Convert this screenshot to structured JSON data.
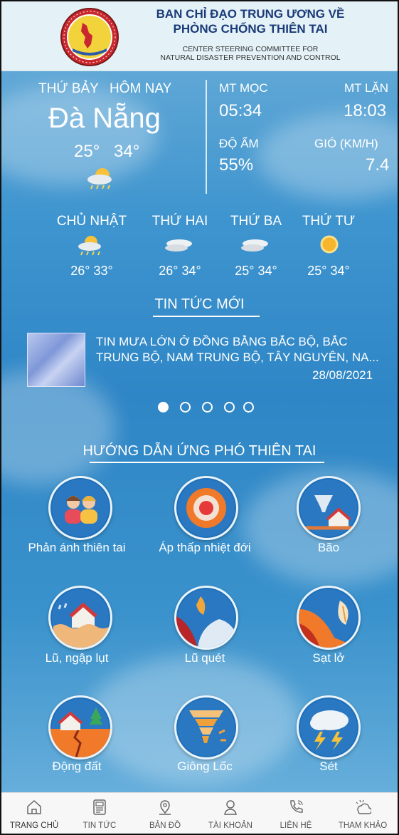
{
  "header": {
    "title_line1": "BAN CHỈ ĐẠO TRUNG ƯƠNG VỀ",
    "title_line2": "PHÒNG CHỐNG THIÊN TAI",
    "subtitle_line1": "CENTER STEERING COMMITTEE FOR",
    "subtitle_line2": "NATURAL DISASTER PREVENTION AND CONTROL",
    "logo_icon": "emblem-seal-icon"
  },
  "weather": {
    "day": "THỨ BẢY",
    "today": "HÔM NAY",
    "city": "Đà Nẵng",
    "temp_min": "25°",
    "temp_max": "34°",
    "icon": "partly-cloudy-rain-icon",
    "sunrise_label": "MT MỌC",
    "sunrise_value": "05:34",
    "sunset_label": "MT LẶN",
    "sunset_value": "18:03",
    "humidity_label": "ĐỘ ẨM",
    "humidity_value": "55%",
    "wind_label": "GIÓ (KM/H)",
    "wind_value": "7.4"
  },
  "forecast": [
    {
      "day": "CHỦ NHẬT",
      "temp": "26° 33°",
      "icon": "partly-cloudy-rain-icon"
    },
    {
      "day": "THỨ HAI",
      "temp": "26° 34°",
      "icon": "cloudy-icon"
    },
    {
      "day": "THỨ BA",
      "temp": "25° 34°",
      "icon": "cloudy-icon"
    },
    {
      "day": "THỨ TƯ",
      "temp": "25° 34°",
      "icon": "sunny-icon"
    }
  ],
  "news": {
    "section_title": "TIN TỨC MỚI",
    "line1": "TIN MƯA LỚN Ở ĐỒNG BẰNG BẮC BỘ, BẮC",
    "line2": "TRUNG BỘ, NAM TRUNG BỘ, TÂY NGUYÊN, NA...",
    "date": "28/08/2021",
    "carousel_pages": 5,
    "active_page": 1
  },
  "guide": {
    "section_title": "HƯỚNG DẪN ỨNG PHÓ THIÊN TAI",
    "items": [
      {
        "label": "Phản ánh thiên tai",
        "icon": "people-report-icon"
      },
      {
        "label": "Áp thấp nhiệt đới",
        "icon": "target-low-pressure-icon"
      },
      {
        "label": "Bão",
        "icon": "storm-house-icon"
      },
      {
        "label": "Lũ, ngập lụt",
        "icon": "flood-house-icon"
      },
      {
        "label": "Lũ quét",
        "icon": "flash-flood-icon"
      },
      {
        "label": "Sạt lở",
        "icon": "landslide-icon"
      },
      {
        "label": "Động đất",
        "icon": "earthquake-icon"
      },
      {
        "label": "Giông Lốc",
        "icon": "tornado-icon"
      },
      {
        "label": "Sét",
        "icon": "lightning-icon"
      }
    ]
  },
  "bottom_nav": [
    {
      "label": "TRANG CHỦ",
      "icon": "home-icon",
      "active": true
    },
    {
      "label": "TIN TỨC",
      "icon": "news-icon"
    },
    {
      "label": "BẢN ĐỒ",
      "icon": "map-pin-icon"
    },
    {
      "label": "TÀI KHOẢN",
      "icon": "account-icon"
    },
    {
      "label": "LIÊN HỆ",
      "icon": "phone-icon"
    },
    {
      "label": "THAM KHẢO",
      "icon": "weather-reference-icon"
    }
  ]
}
